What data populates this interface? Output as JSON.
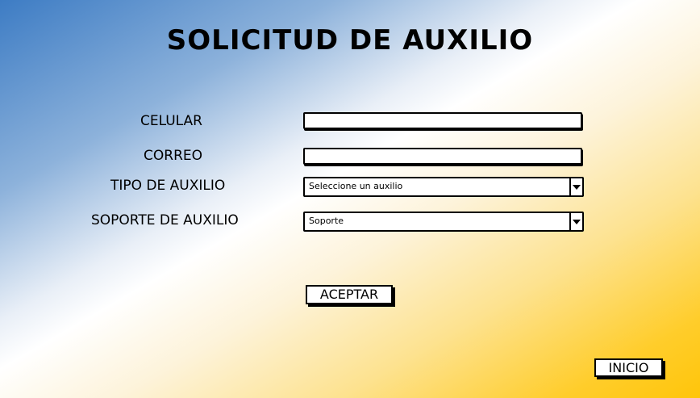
{
  "page": {
    "title": "SOLICITUD DE AUXILIO"
  },
  "form": {
    "celular": {
      "label": "CELULAR",
      "value": ""
    },
    "correo": {
      "label": "CORREO",
      "value": ""
    },
    "tipo_auxilio": {
      "label": "TIPO DE AUXILIO",
      "selected": "Seleccione un auxilio"
    },
    "soporte_auxilio": {
      "label": "SOPORTE DE AUXILIO",
      "selected": "Soporte"
    },
    "submit_label": "ACEPTAR"
  },
  "nav": {
    "home_label": "INICIO"
  },
  "colors": {
    "gradient_blue": "#3d7cc4",
    "gradient_yellow": "#ffc50a"
  },
  "icons": {
    "dropdown": "chevron-down-icon"
  }
}
